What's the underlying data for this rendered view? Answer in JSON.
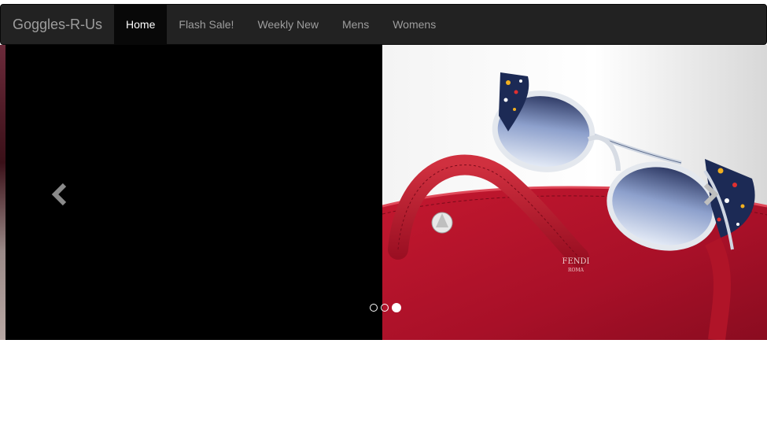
{
  "navbar": {
    "brand": "Goggles-R-Us",
    "items": [
      {
        "label": "Home",
        "active": true
      },
      {
        "label": "Flash Sale!",
        "active": false
      },
      {
        "label": "Weekly New",
        "active": false
      },
      {
        "label": "Mens",
        "active": false
      },
      {
        "label": "Womens",
        "active": false
      }
    ]
  },
  "carousel": {
    "slide_count": 3,
    "active_slide": 3,
    "prev_icon": "chevron-left-icon",
    "next_icon": "chevron-right-icon",
    "product_photo": {
      "subject": "cat-eye sunglasses with confetti-pattern frame on red leather handbag",
      "bag_logo": "FENDI",
      "bag_logo_sub": "ROMA"
    }
  },
  "colors": {
    "navbar_bg": "#222222",
    "nav_active_bg": "#080808",
    "nav_text": "#9d9d9d",
    "nav_active_text": "#ffffff",
    "bag_red": "#b3142e"
  }
}
